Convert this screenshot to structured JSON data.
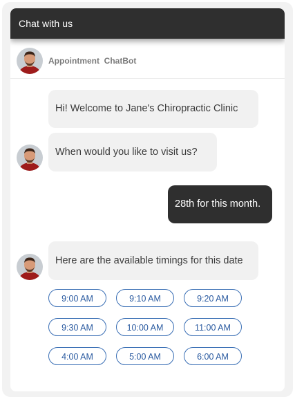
{
  "header": {
    "title": "Chat with us"
  },
  "bot": {
    "name": "Appointment  ChatBot"
  },
  "messages": [
    {
      "from": "bot",
      "text": "Hi! Welcome to Jane's Chiropractic Clinic"
    },
    {
      "from": "bot",
      "text": "When would you like to visit us?"
    },
    {
      "from": "user",
      "text": "28th for this month."
    },
    {
      "from": "bot",
      "text": "Here are the available timings for this date"
    }
  ],
  "time_slots": [
    "9:00 AM",
    "9:10 AM",
    "9:20 AM",
    "9:30 AM",
    "10:00 AM",
    "11:00 AM",
    "4:00 AM",
    "5:00 AM",
    "6:00 AM"
  ],
  "colors": {
    "header_bg": "#2f2f2f",
    "user_bubble": "#2f2f2f",
    "bot_bubble": "#f1f1f1",
    "slot_accent": "#3a6fb5"
  }
}
